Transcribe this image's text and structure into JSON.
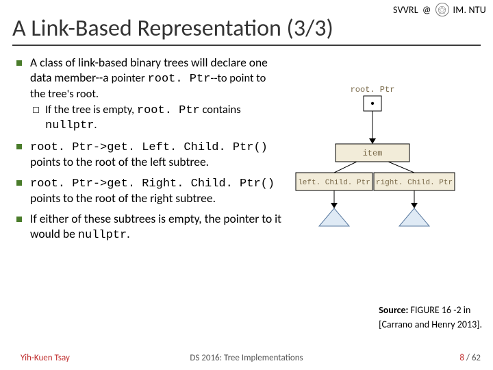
{
  "header": {
    "lab": "SVVRL",
    "at": "@",
    "dept": "IM. NTU"
  },
  "title": "A Link-Based Representation (3/3)",
  "bullets": {
    "b1a": "A class of link-based binary trees will declare one data member--a ",
    "b1b": "pointer",
    "b1c": " ",
    "b1_code": "root. Ptr",
    "b1d": "--to point to the tree's root.",
    "b1_sub_a": "If the tree is empty, ",
    "b1_sub_code1": "root. Ptr",
    "b1_sub_b": " contains ",
    "b1_sub_code2": "nullptr",
    "b1_sub_c": ".",
    "b2_code": "root. Ptr->get. Left. Child. Ptr()",
    "b2_text": " points to the root of the left subtree.",
    "b3_code": "root. Ptr->get. Right. Child. Ptr()",
    "b3_text": " points to the root of the right subtree.",
    "b4a": "If either of these subtrees is empty, the pointer to it would be ",
    "b4_code": "nullptr",
    "b4b": "."
  },
  "figure": {
    "root_label": "root. Ptr",
    "dot": "•",
    "item": "item",
    "left": "left. Child. Ptr",
    "right": "right. Child. Ptr"
  },
  "source": {
    "label": "Source:",
    "line1": " FIGURE 16 -2 in",
    "line2": "[Carrano and Henry 2013]."
  },
  "footer": {
    "author": "Yih-Kuen Tsay",
    "center": "DS 2016: Tree Implementations",
    "page_cur": "8",
    "page_sep": " / ",
    "page_total": "62"
  }
}
